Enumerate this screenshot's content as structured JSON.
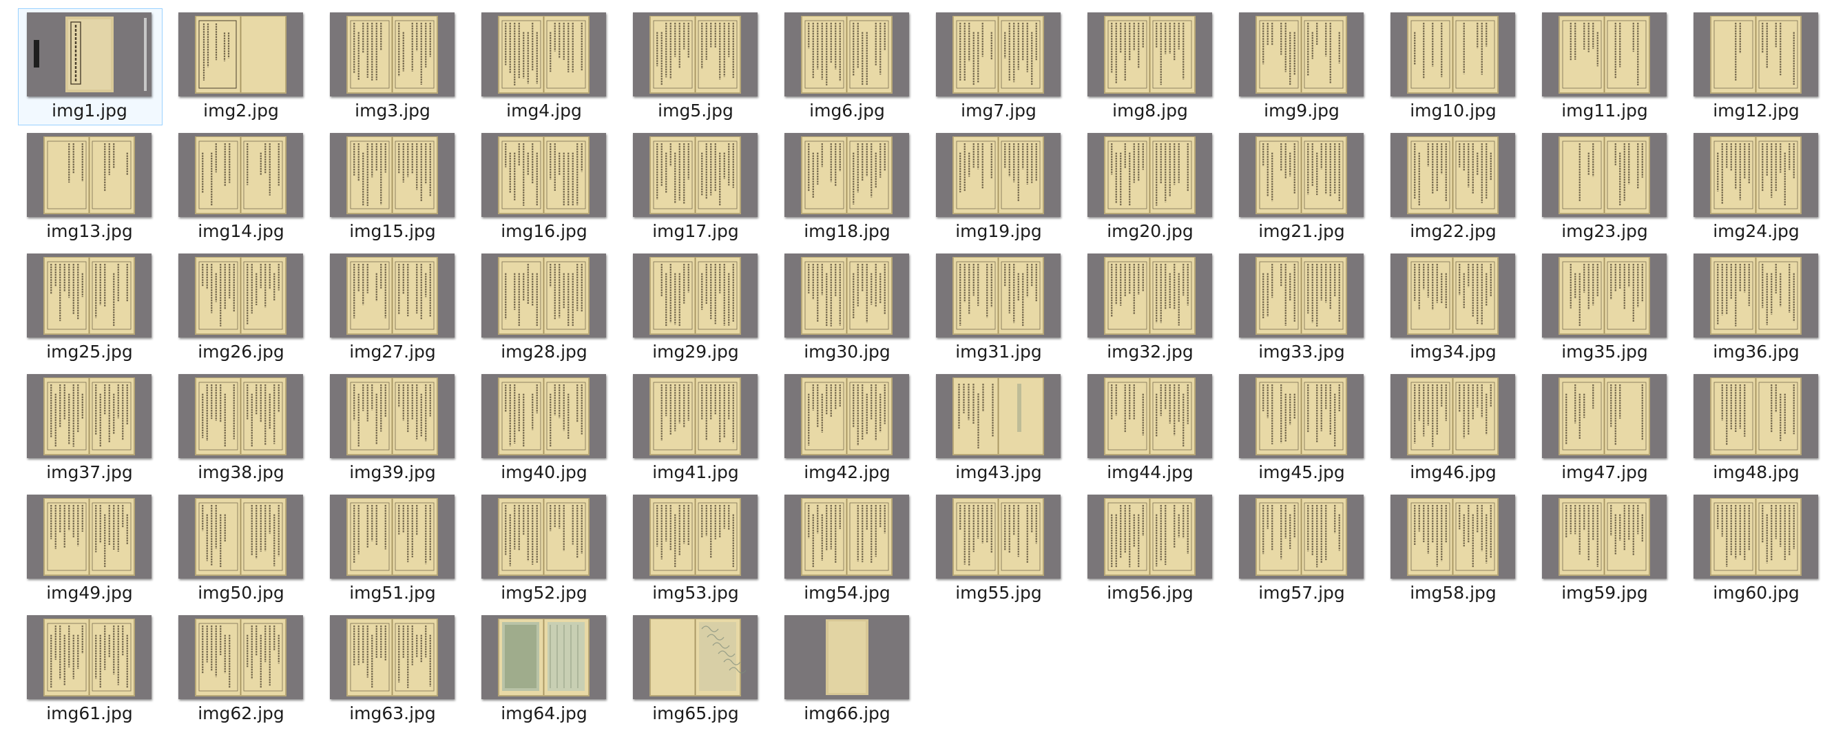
{
  "colors": {
    "background": "#ffffff",
    "thumb_backdrop": "#7a7679",
    "page_paper": "#e8d9a6",
    "page_shadow": "#b8a877",
    "ink": "#4a3f2c",
    "selection_fill": "#cce8ff",
    "selection_border": "#99d1ff",
    "label_text": "#1b1b1b"
  },
  "selected_file": "img1.jpg",
  "files": [
    {
      "name": "img1.jpg",
      "kind": "cover"
    },
    {
      "name": "img2.jpg",
      "kind": "title"
    },
    {
      "name": "img3.jpg",
      "kind": "text"
    },
    {
      "name": "img4.jpg",
      "kind": "text"
    },
    {
      "name": "img5.jpg",
      "kind": "text"
    },
    {
      "name": "img6.jpg",
      "kind": "text"
    },
    {
      "name": "img7.jpg",
      "kind": "text"
    },
    {
      "name": "img8.jpg",
      "kind": "text"
    },
    {
      "name": "img9.jpg",
      "kind": "text"
    },
    {
      "name": "img10.jpg",
      "kind": "sparse"
    },
    {
      "name": "img11.jpg",
      "kind": "sparse"
    },
    {
      "name": "img12.jpg",
      "kind": "sparse"
    },
    {
      "name": "img13.jpg",
      "kind": "sparse"
    },
    {
      "name": "img14.jpg",
      "kind": "sparse"
    },
    {
      "name": "img15.jpg",
      "kind": "text"
    },
    {
      "name": "img16.jpg",
      "kind": "text"
    },
    {
      "name": "img17.jpg",
      "kind": "text"
    },
    {
      "name": "img18.jpg",
      "kind": "text"
    },
    {
      "name": "img19.jpg",
      "kind": "text"
    },
    {
      "name": "img20.jpg",
      "kind": "text"
    },
    {
      "name": "img21.jpg",
      "kind": "text"
    },
    {
      "name": "img22.jpg",
      "kind": "text"
    },
    {
      "name": "img23.jpg",
      "kind": "sparse"
    },
    {
      "name": "img24.jpg",
      "kind": "text"
    },
    {
      "name": "img25.jpg",
      "kind": "text"
    },
    {
      "name": "img26.jpg",
      "kind": "text"
    },
    {
      "name": "img27.jpg",
      "kind": "text"
    },
    {
      "name": "img28.jpg",
      "kind": "text"
    },
    {
      "name": "img29.jpg",
      "kind": "text"
    },
    {
      "name": "img30.jpg",
      "kind": "text"
    },
    {
      "name": "img31.jpg",
      "kind": "text"
    },
    {
      "name": "img32.jpg",
      "kind": "text"
    },
    {
      "name": "img33.jpg",
      "kind": "text"
    },
    {
      "name": "img34.jpg",
      "kind": "text"
    },
    {
      "name": "img35.jpg",
      "kind": "text"
    },
    {
      "name": "img36.jpg",
      "kind": "text"
    },
    {
      "name": "img37.jpg",
      "kind": "text"
    },
    {
      "name": "img38.jpg",
      "kind": "text"
    },
    {
      "name": "img39.jpg",
      "kind": "text"
    },
    {
      "name": "img40.jpg",
      "kind": "text"
    },
    {
      "name": "img41.jpg",
      "kind": "text"
    },
    {
      "name": "img42.jpg",
      "kind": "text"
    },
    {
      "name": "img43.jpg",
      "kind": "halfblank"
    },
    {
      "name": "img44.jpg",
      "kind": "text"
    },
    {
      "name": "img45.jpg",
      "kind": "text"
    },
    {
      "name": "img46.jpg",
      "kind": "text"
    },
    {
      "name": "img47.jpg",
      "kind": "sparse"
    },
    {
      "name": "img48.jpg",
      "kind": "sparse"
    },
    {
      "name": "img49.jpg",
      "kind": "text"
    },
    {
      "name": "img50.jpg",
      "kind": "text"
    },
    {
      "name": "img51.jpg",
      "kind": "text"
    },
    {
      "name": "img52.jpg",
      "kind": "text"
    },
    {
      "name": "img53.jpg",
      "kind": "text"
    },
    {
      "name": "img54.jpg",
      "kind": "text"
    },
    {
      "name": "img55.jpg",
      "kind": "text"
    },
    {
      "name": "img56.jpg",
      "kind": "text"
    },
    {
      "name": "img57.jpg",
      "kind": "text"
    },
    {
      "name": "img58.jpg",
      "kind": "text"
    },
    {
      "name": "img59.jpg",
      "kind": "text"
    },
    {
      "name": "img60.jpg",
      "kind": "text"
    },
    {
      "name": "img61.jpg",
      "kind": "text"
    },
    {
      "name": "img62.jpg",
      "kind": "text"
    },
    {
      "name": "img63.jpg",
      "kind": "text"
    },
    {
      "name": "img64.jpg",
      "kind": "illustration"
    },
    {
      "name": "img65.jpg",
      "kind": "blank-illustration"
    },
    {
      "name": "img66.jpg",
      "kind": "back-cover"
    }
  ]
}
